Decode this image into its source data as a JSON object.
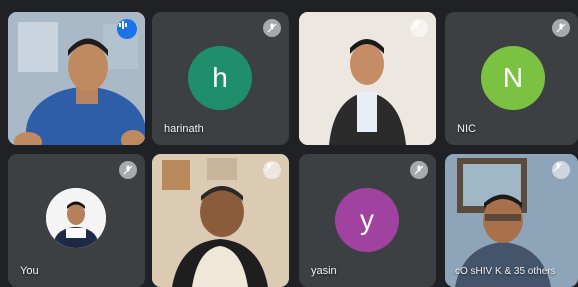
{
  "participants": [
    {
      "name": "harinath",
      "initial": "h",
      "avatar_color": "#1e8e6b"
    },
    {
      "name": "NIC",
      "initial": "N",
      "avatar_color": "#7cc242"
    },
    {
      "name": "You"
    },
    {
      "name": "yasin",
      "initial": "y",
      "avatar_color": "#a142a1"
    }
  ],
  "others": {
    "label": "cO sHIV K & 35 others"
  },
  "colors": {
    "background": "#202124",
    "tile": "#3c4043",
    "active_border": "#8ab4f8",
    "speaking_badge": "#1a73e8"
  }
}
